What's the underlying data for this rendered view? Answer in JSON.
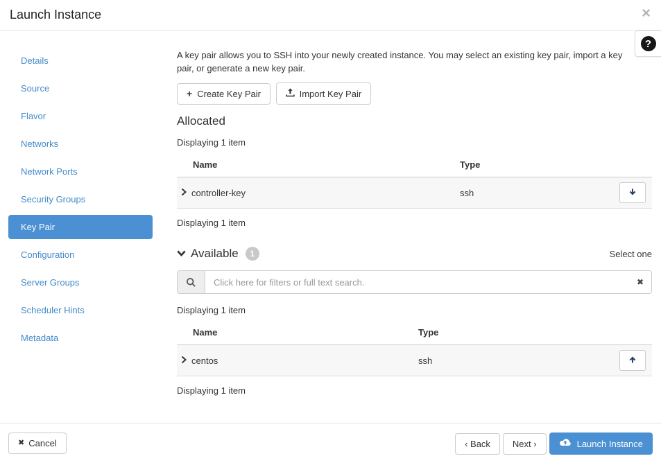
{
  "modal": {
    "title": "Launch Instance"
  },
  "icons": {
    "close": "×",
    "help": "?",
    "plus": "+",
    "cancel_x": "✖",
    "clear_x": "✖"
  },
  "colors": {
    "primary": "#4a90d2",
    "link": "#428bca",
    "row_bg": "#f7f7f7"
  },
  "sidebar": {
    "items": [
      {
        "label": "Details"
      },
      {
        "label": "Source"
      },
      {
        "label": "Flavor"
      },
      {
        "label": "Networks"
      },
      {
        "label": "Network Ports"
      },
      {
        "label": "Security Groups"
      },
      {
        "label": "Key Pair",
        "active": true
      },
      {
        "label": "Configuration"
      },
      {
        "label": "Server Groups"
      },
      {
        "label": "Scheduler Hints"
      },
      {
        "label": "Metadata"
      }
    ]
  },
  "content": {
    "description": "A key pair allows you to SSH into your newly created instance. You may select an existing key pair, import a key pair, or generate a new key pair.",
    "actions": {
      "create": "Create Key Pair",
      "import": "Import Key Pair"
    },
    "allocated": {
      "heading": "Allocated",
      "count_top": "Displaying 1 item",
      "count_bottom": "Displaying 1 item",
      "columns": {
        "name": "Name",
        "type": "Type"
      },
      "rows": [
        {
          "name": "controller-key",
          "type": "ssh",
          "action": "move-down"
        }
      ]
    },
    "available": {
      "heading": "Available",
      "badge": "1",
      "select_hint": "Select one",
      "search_placeholder": "Click here for filters or full text search.",
      "count_top": "Displaying 1 item",
      "count_bottom": "Displaying 1 item",
      "columns": {
        "name": "Name",
        "type": "Type"
      },
      "rows": [
        {
          "name": "centos",
          "type": "ssh",
          "action": "move-up"
        }
      ]
    }
  },
  "footer": {
    "cancel": "Cancel",
    "back": "‹ Back",
    "next": "Next ›",
    "launch": "Launch Instance"
  }
}
